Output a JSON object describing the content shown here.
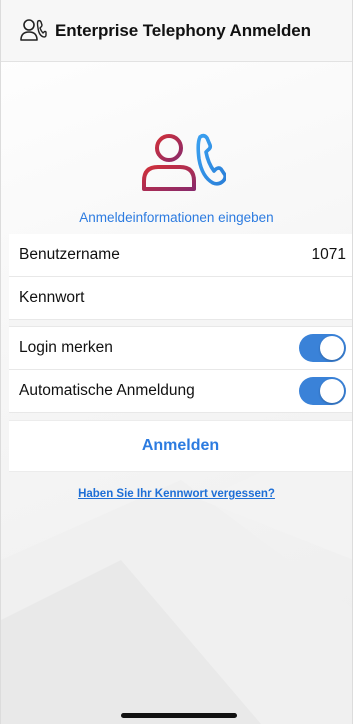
{
  "header": {
    "title": "Enterprise Telephony Anmelden",
    "icon": "contact-phone-icon"
  },
  "logo": {
    "icon": "user-phone-logo-icon",
    "colors": {
      "person": "#c0303a",
      "phone": "#2f8fe8"
    }
  },
  "subtitle": "Anmeldeinformationen eingeben",
  "form": {
    "username_label": "Benutzername",
    "username_value": "1071",
    "password_label": "Kennwort",
    "remember_label": "Login merken",
    "remember_on": true,
    "autologin_label": "Automatische Anmeldung",
    "autologin_on": true
  },
  "actions": {
    "signin_label": "Anmelden",
    "forgot_label": "Haben Sie Ihr Kennwort vergessen?"
  },
  "colors": {
    "accent": "#2c7be0",
    "toggle_on": "#3a82d8"
  }
}
